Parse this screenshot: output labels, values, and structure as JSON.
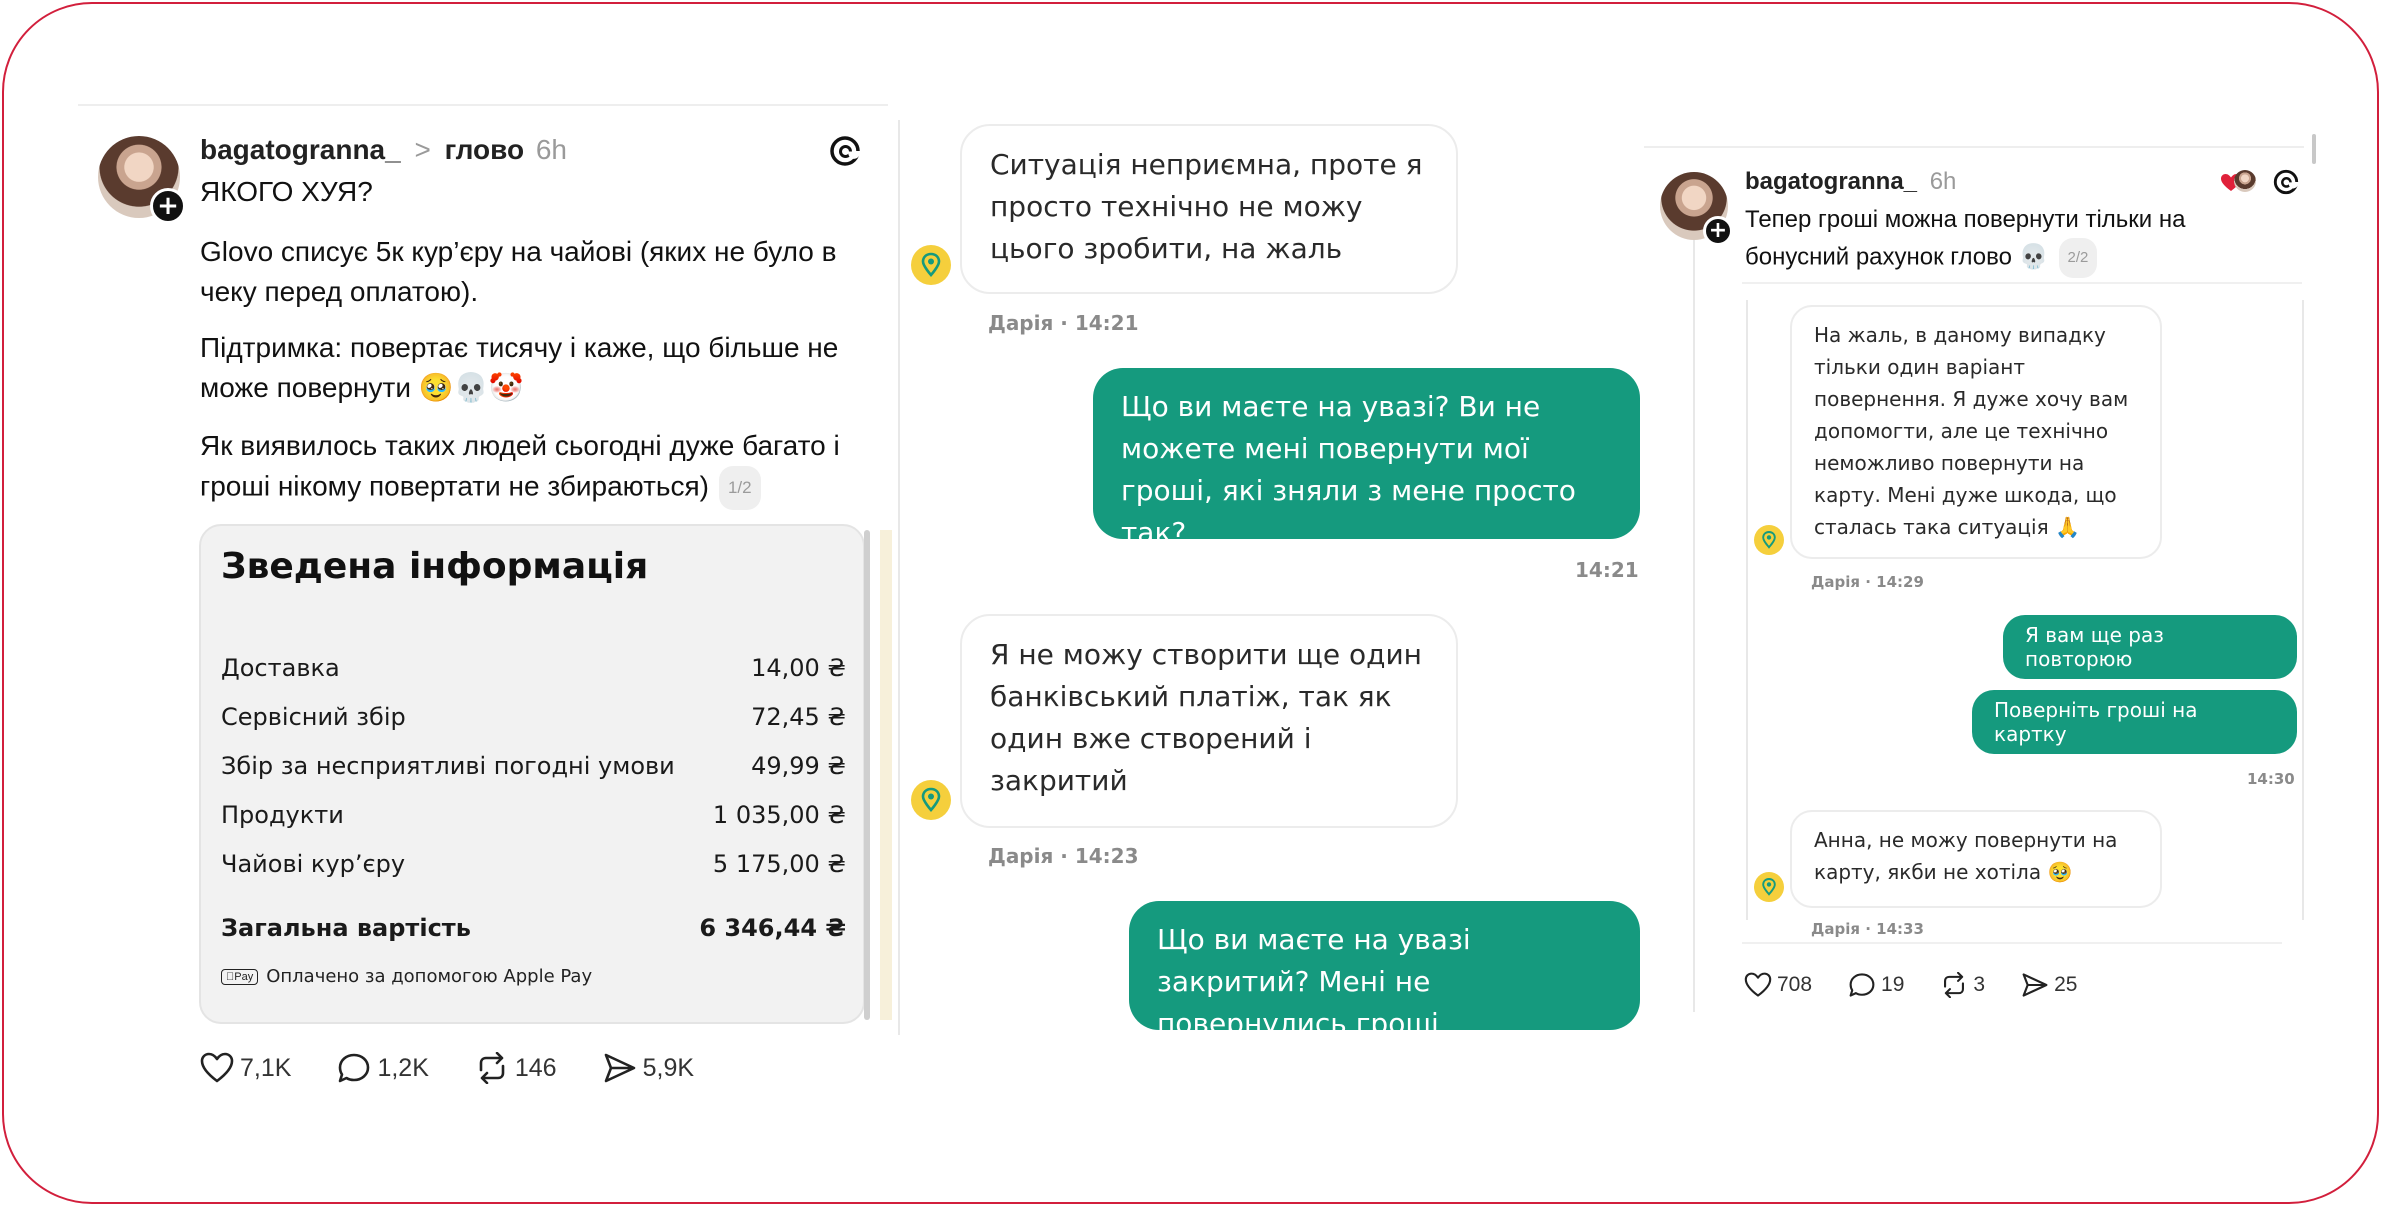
{
  "left_post": {
    "username": "bagatogranna_",
    "arrow": ">",
    "community": "глово",
    "time": "6h",
    "title": "ЯКОГО ХУЯ?",
    "p1": "Glovo списує 5к кур’єру на чайові (яких не було в чеку перед оплатою).",
    "p2": "Підтримка: повертає тисячу і каже, що більше не може повернути 🥹💀🤡",
    "p3": "Як виявилось таких людей сьогодні дуже багато і гроші нікому повертати не збираються)",
    "pager": "1/2",
    "summary": {
      "title": "Зведена інформація",
      "rows": [
        {
          "label": "Доставка",
          "value": "14,00 ₴"
        },
        {
          "label": "Сервісний збір",
          "value": "72,45 ₴"
        },
        {
          "label": "Збір за несприятливі погодні умови",
          "value": "49,99 ₴"
        },
        {
          "label": "Продукти",
          "value": "1 035,00 ₴"
        },
        {
          "label": "Чайові кур’єру",
          "value": "5 175,00 ₴"
        }
      ],
      "total_label": "Загальна вартість",
      "total_value": "6 346,44 ₴",
      "pay_badge": "Pay",
      "paid_note": "Оплачено за допомогою Apple Pay"
    },
    "actions": {
      "likes": "7,1K",
      "replies": "1,2K",
      "reposts": "146",
      "shares": "5,9K"
    }
  },
  "chat": {
    "m1": "Ситуація неприємна, проте я просто технічно не можу цього зробити, на жаль",
    "m1_meta": "Дарія · 14:21",
    "m2": "Що ви маєте на увазі? Ви не можете мені повернути мої гроші, які зняли з мене просто так?",
    "m2_time": "14:21",
    "m3": "Я не можу створити ще один банківський платіж, так як один вже створений і закритий",
    "m3_meta": "Дарія · 14:23",
    "m4": "Що ви маєте на увазі закритий? Мені не повернулись гроші"
  },
  "right_post": {
    "username": "bagatogranna_",
    "time": "6h",
    "text": "Тепер гроші можна повернути тільки на бонусний рахунок глово 💀",
    "pager": "2/2",
    "r1": "На жаль, в даному випадку тільки один варіант повернення. Я дуже хочу вам допомогти, але це технічно неможливо повернути на карту. Мені дуже шкода, що сталась така ситуація 🙏",
    "r1_meta": "Дарія · 14:29",
    "r2": "Я вам ще раз повторюю",
    "r3": "Поверніть гроші на картку",
    "r3_time": "14:30",
    "r4": "Анна, не можу повернути на карту, якби не хотіла 🥹",
    "r4_meta": "Дарія · 14:33",
    "actions": {
      "likes": "708",
      "replies": "19",
      "reposts": "3",
      "shares": "25"
    }
  },
  "colors": {
    "frame": "#d21f3c",
    "glovo_green": "#159a7e",
    "glovo_yellow": "#f5cf3c"
  }
}
